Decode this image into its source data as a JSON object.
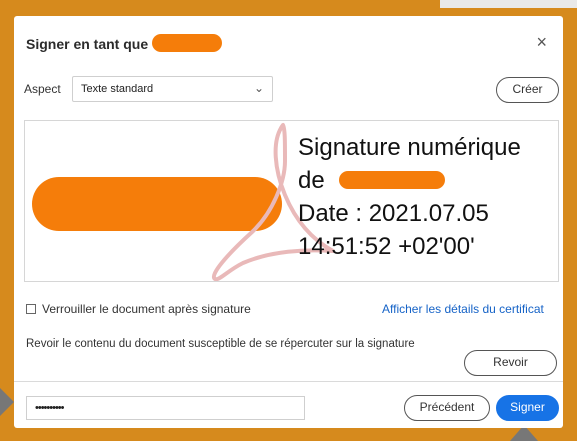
{
  "dialog": {
    "title": "Signer en tant que",
    "close_glyph": "×"
  },
  "aspect": {
    "label": "Aspect",
    "selected": "Texte standard",
    "chevron": "⌄"
  },
  "buttons": {
    "create": "Créer",
    "review": "Revoir",
    "previous": "Précédent",
    "sign": "Signer"
  },
  "preview": {
    "line1": "Signature numérique",
    "line2_prefix": "de",
    "line3": "Date : 2021.07.05",
    "line4": "14:51:52 +02'00'"
  },
  "options": {
    "lock_document": "Verrouiller le document après signature",
    "certificate_link": "Afficher les détails du certificat",
    "review_text": "Revoir le contenu du document susceptible de se répercuter sur la signature"
  },
  "password": {
    "value": "••••••••••"
  },
  "colors": {
    "frame": "#d68a1d",
    "redaction": "#f57d0a",
    "accent": "#1773e6",
    "link": "#1663c7"
  }
}
